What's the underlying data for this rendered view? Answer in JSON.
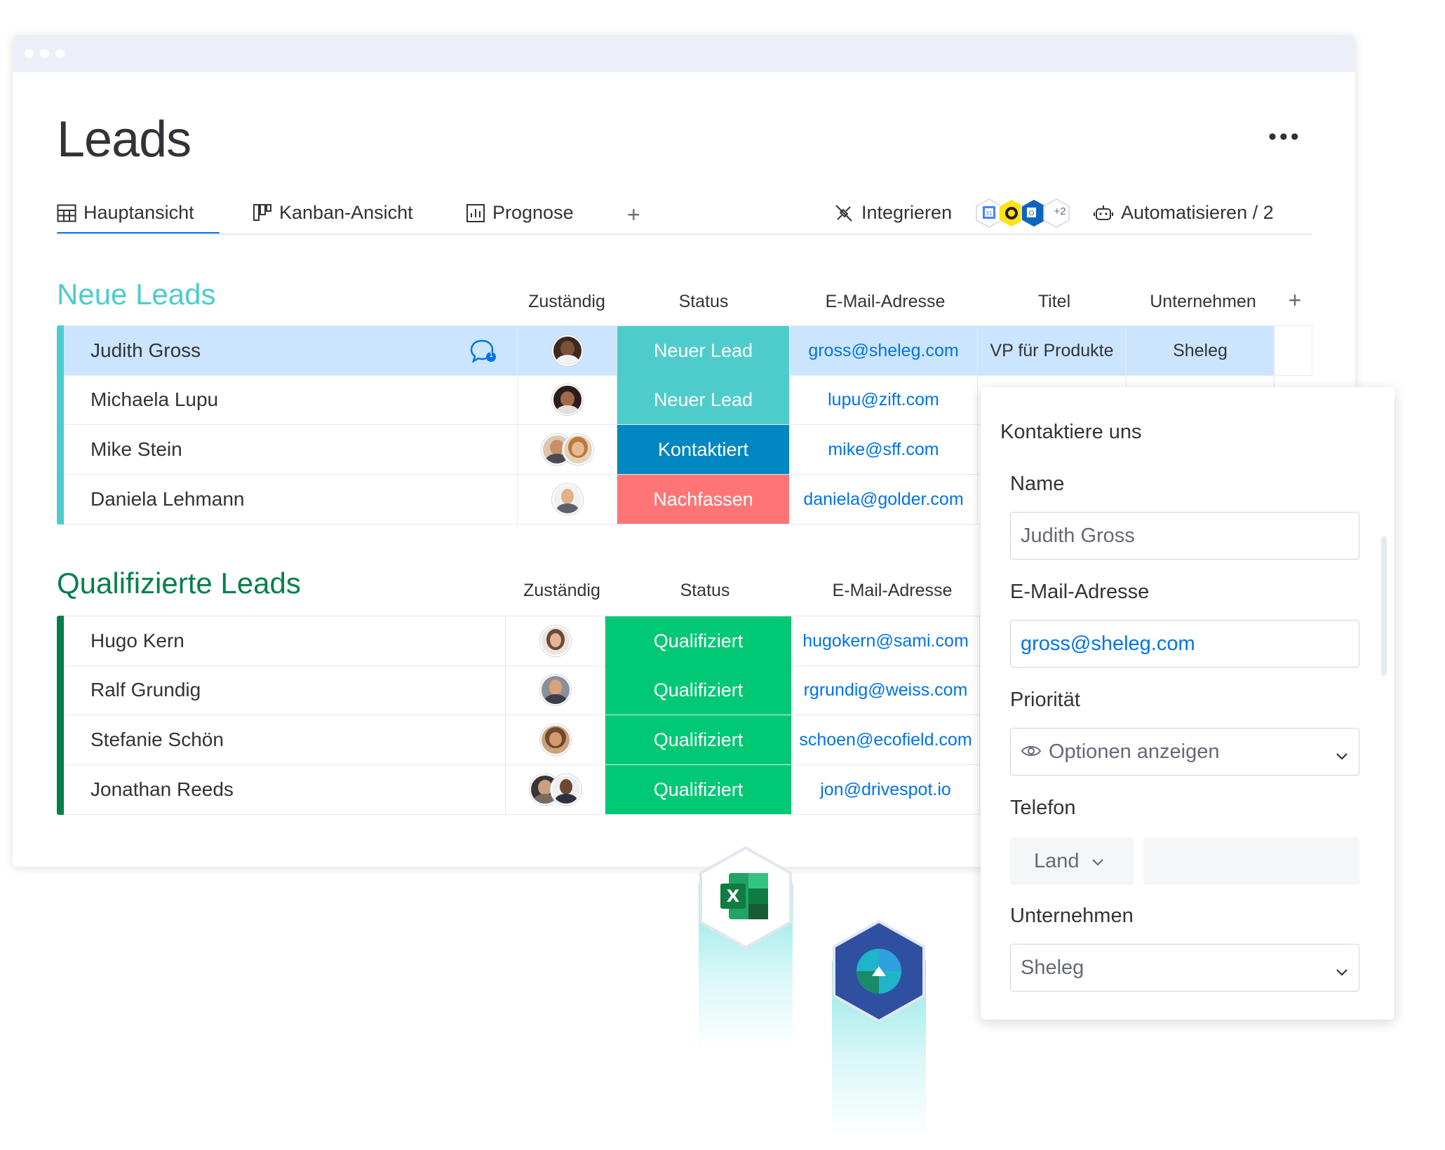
{
  "page": {
    "title": "Leads"
  },
  "tabs": [
    {
      "label": "Hauptansicht",
      "icon": "table-icon"
    },
    {
      "label": "Kanban-Ansicht",
      "icon": "kanban-icon"
    },
    {
      "label": "Prognose",
      "icon": "chart-icon"
    }
  ],
  "toolbar": {
    "add_tab": "+",
    "integrate_label": "Integrieren",
    "integration_count": "+2",
    "automate_label": "Automatisieren / 2",
    "more": "•••"
  },
  "group_new": {
    "title": "Neue Leads",
    "color": "#4ecccc",
    "columns": {
      "owner": "Zuständig",
      "status": "Status",
      "email": "E-Mail-Adresse",
      "title": "Titel",
      "company": "Unternehmen",
      "add": "+"
    },
    "rows": [
      {
        "name": "Judith Gross",
        "status": "Neuer Lead",
        "status_color": "#4ecccc",
        "email": "gross@sheleg.com",
        "title": "VP für Produkte",
        "company": "Sheleg",
        "comment_count": "1"
      },
      {
        "name": "Michaela Lupu",
        "status": "Neuer Lead",
        "status_color": "#4ecccc",
        "email": "lupu@zift.com"
      },
      {
        "name": "Mike Stein",
        "status": "Kontaktiert",
        "status_color": "#0086c0",
        "email": "mike@sff.com"
      },
      {
        "name": "Daniela Lehmann",
        "status": "Nachfassen",
        "status_color": "#ff7575",
        "email": "daniela@golder.com"
      }
    ]
  },
  "group_qualified": {
    "title": "Qualifizierte Leads",
    "color": "#037f4c",
    "columns": {
      "owner": "Zuständig",
      "status": "Status",
      "email": "E-Mail-Adresse"
    },
    "rows": [
      {
        "name": "Hugo Kern",
        "status": "Qualifiziert",
        "status_color": "#00c875",
        "email": "hugokern@sami.com"
      },
      {
        "name": "Ralf Grundig",
        "status": "Qualifiziert",
        "status_color": "#00c875",
        "email": "rgrundig@weiss.com"
      },
      {
        "name": "Stefanie Schön",
        "status": "Qualifiziert",
        "status_color": "#00c875",
        "email": "schoen@ecofield.com"
      },
      {
        "name": "Jonathan Reeds",
        "status": "Qualifiziert",
        "status_color": "#00c875",
        "email": "jon@drivespot.io"
      }
    ]
  },
  "form": {
    "heading": "Kontaktiere uns",
    "name_label": "Name",
    "name_value": "Judith Gross",
    "email_label": "E-Mail-Adresse",
    "email_value": "gross@sheleg.com",
    "priority_label": "Priorität",
    "priority_value": "Optionen anzeigen",
    "phone_label": "Telefon",
    "country_value": "Land",
    "company_label": "Unternehmen",
    "company_value": "Sheleg"
  },
  "integration_icons": [
    "excel-icon",
    "azure-devops-icon"
  ]
}
